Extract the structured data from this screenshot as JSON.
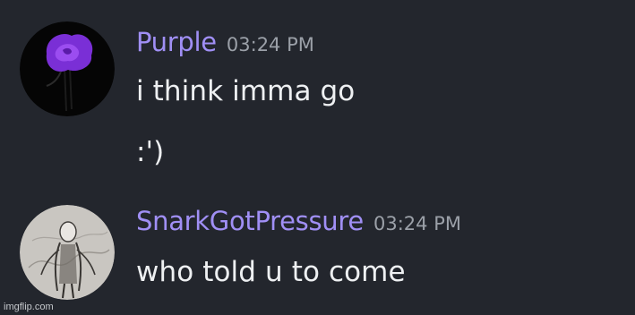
{
  "messages": [
    {
      "author": "Purple",
      "timestamp": "03:24 PM",
      "avatar": "purple-rose-avatar",
      "lines": [
        "i think imma go",
        ":')"
      ]
    },
    {
      "author": "SnarkGotPressure",
      "timestamp": "03:24 PM",
      "avatar": "sketch-figure-avatar",
      "lines": [
        "who told u to come"
      ]
    }
  ],
  "watermark": "imgflip.com",
  "colors": {
    "background": "#23262d",
    "username": "#a08ff5",
    "timestamp": "#9ba0a8",
    "message_text": "#eef0f2"
  }
}
